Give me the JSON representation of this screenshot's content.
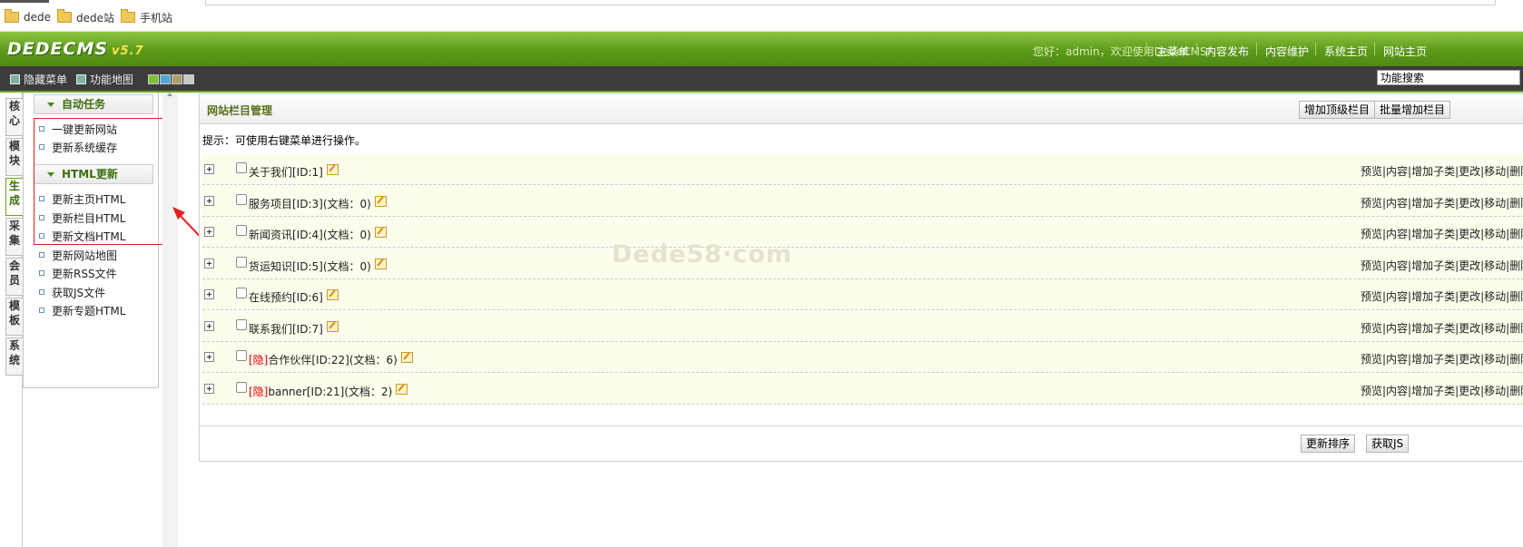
{
  "bookmarks": [
    "dede",
    "dede站",
    "手机站"
  ],
  "header": {
    "logo": "DEDECMS",
    "version": "v5.7",
    "welcome": "您好：admin，欢迎使用DedeCMS!",
    "nav": [
      "主菜单",
      "内容发布",
      "内容维护",
      "系统主页",
      "网站主页"
    ]
  },
  "toolbar": {
    "hide_menu": "隐藏菜单",
    "site_map": "功能地图",
    "search_value": "功能搜索",
    "skin_colors": [
      "#7fbf3a",
      "#52a6d8",
      "#a9a06a",
      "#c8c8c8"
    ]
  },
  "left_tabs": [
    {
      "label": "核心",
      "active": false
    },
    {
      "label": "模块",
      "active": false
    },
    {
      "label": "生成",
      "active": true
    },
    {
      "label": "采集",
      "active": false
    },
    {
      "label": "会员",
      "active": false
    },
    {
      "label": "模板",
      "active": false
    },
    {
      "label": "系统",
      "active": false
    }
  ],
  "menu": {
    "group1": "自动任务",
    "group1_items": [
      "一键更新网站",
      "更新系统缓存"
    ],
    "group2": "HTML更新",
    "group2_items": [
      "更新主页HTML",
      "更新栏目HTML",
      "更新文档HTML",
      "更新网站地图",
      "更新RSS文件",
      "获取JS文件",
      "更新专题HTML"
    ]
  },
  "main": {
    "title": "网站栏目管理",
    "add_top_button": "增加顶级栏目",
    "batch_add_button": "批量增加栏目",
    "tip": "提示：可使用右键菜单进行操作。",
    "ops": "预览|内容|增加子类|更改|移动|删除",
    "rows": [
      {
        "hidden": "",
        "name": "关于我们[ID:1]"
      },
      {
        "hidden": "",
        "name": "服务项目[ID:3](文档：0)"
      },
      {
        "hidden": "",
        "name": "新闻资讯[ID:4](文档：0)"
      },
      {
        "hidden": "",
        "name": "货运知识[ID:5](文档：0)"
      },
      {
        "hidden": "",
        "name": "在线预约[ID:6]"
      },
      {
        "hidden": "",
        "name": "联系我们[ID:7]"
      },
      {
        "hidden": "[隐]",
        "name": "合作伙伴[ID:22](文档：6)"
      },
      {
        "hidden": "[隐]",
        "name": "banner[ID:21](文档：2)"
      }
    ],
    "update_order_button": "更新排序",
    "get_js_button": "获取JS"
  },
  "watermark": "Dede58·com"
}
